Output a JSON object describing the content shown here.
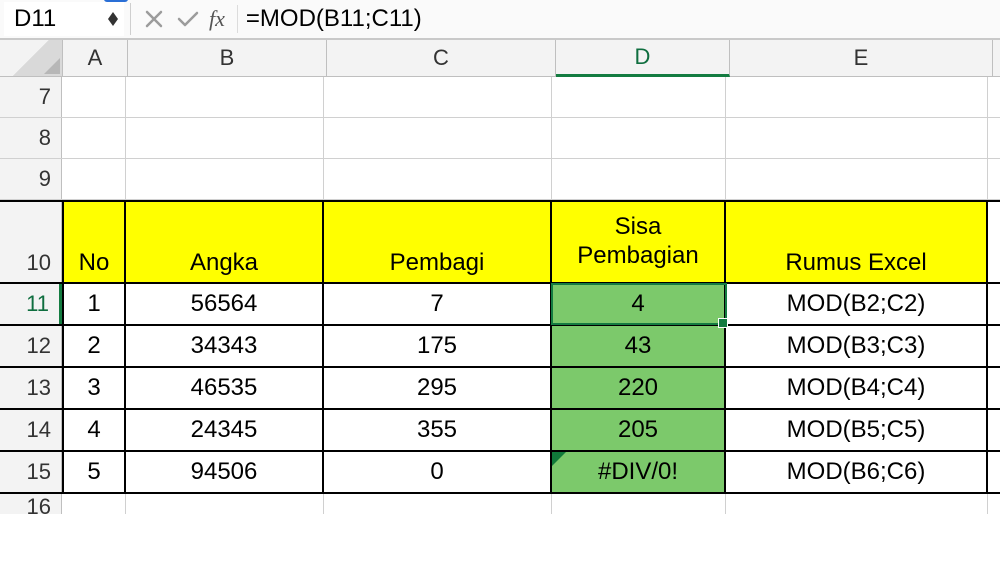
{
  "formula_bar": {
    "cell_ref": "D11",
    "fx_label": "fx",
    "formula": "=MOD(B11;C11)"
  },
  "columns": [
    "A",
    "B",
    "C",
    "D",
    "E"
  ],
  "selected_col": "D",
  "row_headers": [
    "7",
    "8",
    "9",
    "10",
    "11",
    "12",
    "13",
    "14",
    "15",
    "16"
  ],
  "selected_row": "11",
  "table": {
    "headers": {
      "no": "No",
      "angka": "Angka",
      "pembagi": "Pembagi",
      "sisa_line1": "Sisa",
      "sisa_line2": "Pembagian",
      "rumus": "Rumus Excel"
    },
    "rows": [
      {
        "no": "1",
        "angka": "56564",
        "pembagi": "7",
        "sisa": "4",
        "rumus": "MOD(B2;C2)"
      },
      {
        "no": "2",
        "angka": "34343",
        "pembagi": "175",
        "sisa": "43",
        "rumus": "MOD(B3;C3)"
      },
      {
        "no": "3",
        "angka": "46535",
        "pembagi": "295",
        "sisa": "220",
        "rumus": "MOD(B4;C4)"
      },
      {
        "no": "4",
        "angka": "24345",
        "pembagi": "355",
        "sisa": "205",
        "rumus": "MOD(B5;C5)"
      },
      {
        "no": "5",
        "angka": "94506",
        "pembagi": "0",
        "sisa": "#DIV/0!",
        "rumus": "MOD(B6;C6)"
      }
    ]
  },
  "chart_data": {
    "type": "table",
    "title": "MOD function example (Sisa Pembagian)",
    "columns": [
      "No",
      "Angka",
      "Pembagi",
      "Sisa Pembagian",
      "Rumus Excel"
    ],
    "rows": [
      [
        1,
        56564,
        7,
        4,
        "MOD(B2;C2)"
      ],
      [
        2,
        34343,
        175,
        43,
        "MOD(B3;C3)"
      ],
      [
        3,
        46535,
        295,
        220,
        "MOD(B4;C4)"
      ],
      [
        4,
        24345,
        355,
        205,
        "MOD(B5;C5)"
      ],
      [
        5,
        94506,
        0,
        "#DIV/0!",
        "MOD(B6;C6)"
      ]
    ]
  }
}
